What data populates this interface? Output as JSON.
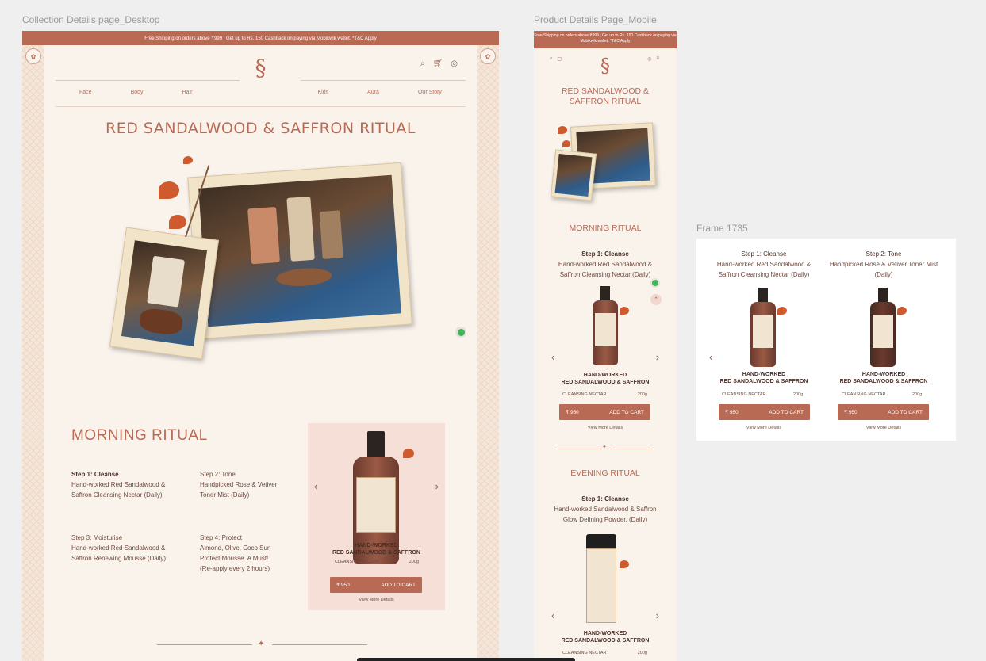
{
  "labels": {
    "desktop": "Collection Details page_Desktop",
    "mobile": "Product Details Page_Mobile",
    "frame": "Frame 1735"
  },
  "desktop": {
    "banner": "Free Shipping on orders above ₹999 | Get up to Rs. 150 Cashback on paying via Mobikwik wallet. *T&C Apply",
    "nav": [
      "Face",
      "Body",
      "Hair",
      "Kids",
      "Aura",
      "Our Story"
    ],
    "title": "RED SANDALWOOD & SAFFRON RITUAL",
    "ritual_title": "MORNING RITUAL",
    "steps": [
      {
        "head": "Step 1: Cleanse",
        "text": "Hand-worked Red Sandalwood & Saffron Cleansing Nectar (Daily)"
      },
      {
        "head": "Step 2: Tone",
        "text": "Handpicked Rose & Vetiver Toner Mist (Daily)"
      },
      {
        "head": "Step 3: Moisturise",
        "text": "Hand-worked Red Sandalwood & Saffron Renewing Mousse (Daily)"
      },
      {
        "head": "Step 4: Protect",
        "text": "Almond, Olive, Coco Sun Protect Mousse. A Must! (Re-apply every 2 hours)"
      }
    ],
    "product": {
      "name_line1": "HAND-WORKED",
      "name_line2": "RED SANDALWOOD & SAFFRON",
      "type": "CLEANSING NECTAR",
      "size": "200g",
      "price": "₹ 950",
      "cta": "ADD TO CART",
      "details": "View More Details"
    }
  },
  "mobile": {
    "banner": "Free Shipping on orders above ₹999 | Get up to Rs. 150 Cashback on paying via Mobikwik wallet. *T&C Apply",
    "title": "RED SANDALWOOD & SAFFRON RITUAL",
    "morning": "MORNING RITUAL",
    "morning_step_head": "Step 1: Cleanse",
    "morning_step_text": "Hand-worked Red Sandalwood & Saffron Cleansing Nectar (Daily)",
    "evening": "EVENING RITUAL",
    "evening_step_head": "Step 1: Cleanse",
    "evening_step_text": "Hand-worked Sandalwood & Saffron Glow Defining Powder. (Daily)",
    "product": {
      "name_line1": "HAND-WORKED",
      "name_line2": "RED SANDALWOOD & SAFFRON",
      "type": "CLEANSING NECTAR",
      "size": "200g",
      "price": "₹ 950",
      "cta": "ADD TO CART",
      "details": "View More Details"
    }
  },
  "frame": {
    "cards": [
      {
        "head": "Step 1: Cleanse",
        "text": "Hand-worked Red Sandalwood & Saffron Cleansing Nectar (Daily)",
        "name_line1": "HAND-WORKED",
        "name_line2": "RED SANDALWOOD & SAFFRON",
        "type": "CLEANSING NECTAR",
        "size": "200g",
        "price": "₹ 950",
        "cta": "ADD TO CART",
        "details": "View More Details"
      },
      {
        "head": "Step 2: Tone",
        "text": "Handpicked Rose & Vetiver Toner Mist (Daily)",
        "name_line1": "HAND-WORKED",
        "name_line2": "RED SANDALWOOD & SAFFRON",
        "type": "CLEANSING NECTAR",
        "size": "200g",
        "price": "₹ 950",
        "cta": "ADD TO CART",
        "details": "View More Details"
      }
    ]
  },
  "colors": {
    "accent": "#b96a55",
    "background": "#faf3ec",
    "card": "#f5dfd6"
  }
}
